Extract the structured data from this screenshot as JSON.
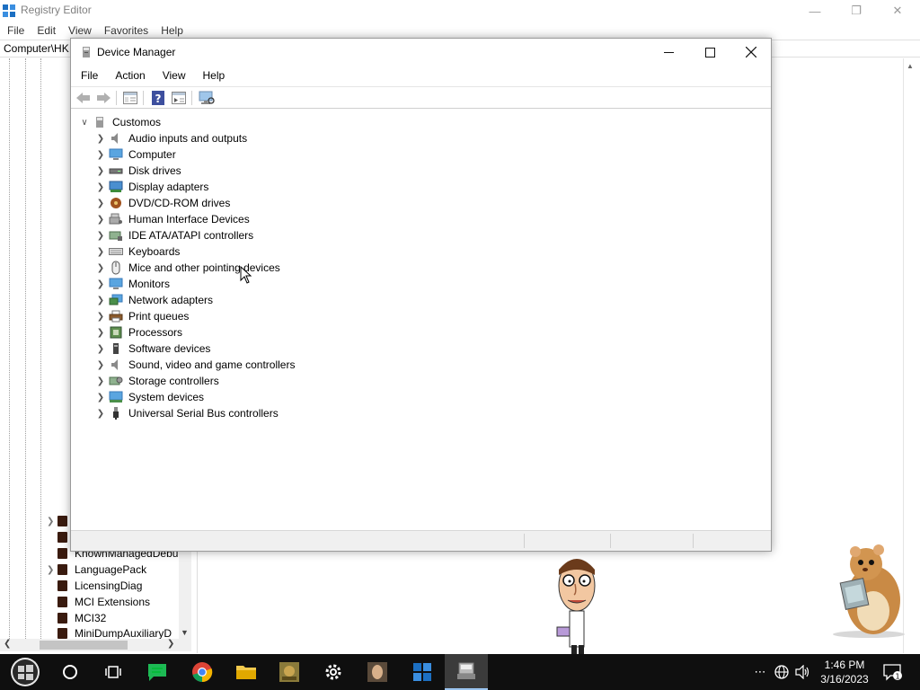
{
  "registry_editor": {
    "title": "Registry Editor",
    "menu": [
      "File",
      "Edit",
      "View",
      "Favorites",
      "Help"
    ],
    "address": "Computer\\HK",
    "tree_items": [
      {
        "label": ""
      },
      {
        "label": ""
      },
      {
        "label": "KnownManagedDebu"
      },
      {
        "label": "LanguagePack"
      },
      {
        "label": "LicensingDiag"
      },
      {
        "label": "MCI Extensions"
      },
      {
        "label": "MCI32"
      },
      {
        "label": "MiniDumpAuxiliaryD"
      }
    ]
  },
  "device_manager": {
    "title": "Device Manager",
    "menu": [
      "File",
      "Action",
      "View",
      "Help"
    ],
    "root": "Customos",
    "categories": [
      {
        "label": "Audio inputs and outputs",
        "icon": "speaker-icon"
      },
      {
        "label": "Computer",
        "icon": "monitor-icon"
      },
      {
        "label": "Disk drives",
        "icon": "disk-drive-icon"
      },
      {
        "label": "Display adapters",
        "icon": "display-adapter-icon"
      },
      {
        "label": "DVD/CD-ROM drives",
        "icon": "dvd-icon"
      },
      {
        "label": "Human Interface Devices",
        "icon": "hid-icon"
      },
      {
        "label": "IDE ATA/ATAPI controllers",
        "icon": "ide-controller-icon"
      },
      {
        "label": "Keyboards",
        "icon": "keyboard-icon"
      },
      {
        "label": "Mice and other pointing devices",
        "icon": "mouse-icon"
      },
      {
        "label": "Monitors",
        "icon": "monitor-icon"
      },
      {
        "label": "Network adapters",
        "icon": "network-adapter-icon"
      },
      {
        "label": "Print queues",
        "icon": "printer-icon"
      },
      {
        "label": "Processors",
        "icon": "processor-icon"
      },
      {
        "label": "Software devices",
        "icon": "software-device-icon"
      },
      {
        "label": "Sound, video and game controllers",
        "icon": "sound-icon"
      },
      {
        "label": "Storage controllers",
        "icon": "storage-controller-icon"
      },
      {
        "label": "System devices",
        "icon": "system-device-icon"
      },
      {
        "label": "Universal Serial Bus controllers",
        "icon": "usb-icon"
      }
    ]
  },
  "taskbar": {
    "apps": [
      "start-button",
      "cortana-icon",
      "task-view-icon",
      "notes-app-icon",
      "chrome-icon",
      "file-explorer-icon",
      "game-app-icon",
      "settings-icon",
      "app-icon",
      "registry-editor-icon",
      "device-manager-icon"
    ],
    "clock_time": "1:46 PM",
    "clock_date": "3/16/2023",
    "notification_count": "1"
  },
  "colors": {
    "taskbar": "#0f0f0f",
    "accent": "#9ac3ee",
    "folder": "#3a1b0f"
  }
}
